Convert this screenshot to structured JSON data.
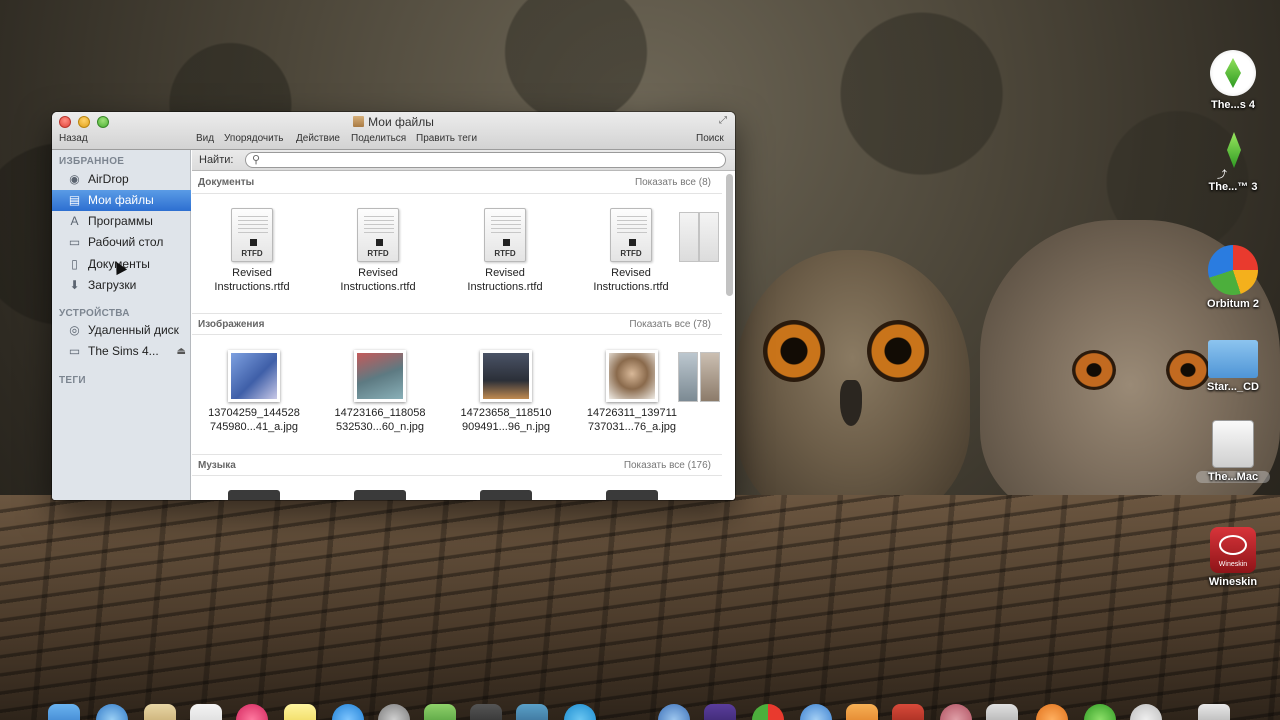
{
  "window": {
    "title": "Мои файлы",
    "toolbar": {
      "back": "Назад",
      "view": "Вид",
      "arrange": "Упорядочить",
      "action": "Действие",
      "share": "Поделиться",
      "tags": "Править теги",
      "search": "Поиск"
    },
    "sidebar": {
      "favorites_header": "ИЗБРАННОЕ",
      "favorites": [
        {
          "label": "AirDrop",
          "icon": "airdrop-icon"
        },
        {
          "label": "Мои файлы",
          "icon": "all-files-icon",
          "selected": true
        },
        {
          "label": "Программы",
          "icon": "applications-icon"
        },
        {
          "label": "Рабочий стол",
          "icon": "desktop-icon"
        },
        {
          "label": "Документы",
          "icon": "documents-icon"
        },
        {
          "label": "Загрузки",
          "icon": "downloads-icon"
        }
      ],
      "devices_header": "УСТРОЙСТВА",
      "devices": [
        {
          "label": "Удаленный диск",
          "icon": "remote-disc-icon"
        },
        {
          "label": "The Sims 4...",
          "icon": "disk-icon",
          "eject": "⏏"
        }
      ],
      "tags_header": "ТЕГИ"
    },
    "search_bar": {
      "label": "Найти:",
      "value": "",
      "placeholder": ""
    },
    "sections": [
      {
        "title": "Документы",
        "show_all": "Показать все (8)",
        "items": [
          {
            "name_line1": "Revised",
            "name_line2": "Instructions.rtfd",
            "ext": "RTFD"
          },
          {
            "name_line1": "Revised",
            "name_line2": "Instructions.rtfd",
            "ext": "RTFD"
          },
          {
            "name_line1": "Revised",
            "name_line2": "Instructions.rtfd",
            "ext": "RTFD"
          },
          {
            "name_line1": "Revised",
            "name_line2": "Instructions.rtfd",
            "ext": "RTFD"
          }
        ]
      },
      {
        "title": "Изображения",
        "show_all": "Показать все (78)",
        "items": [
          {
            "name_line1": "13704259_144528",
            "name_line2": "745980...41_a.jpg",
            "color": "#3f5fa8"
          },
          {
            "name_line1": "14723166_118058",
            "name_line2": "532530...60_n.jpg",
            "color": "#5d7a82"
          },
          {
            "name_line1": "14723658_118510",
            "name_line2": "909491...96_n.jpg",
            "color": "#2b2f38"
          },
          {
            "name_line1": "14726311_139711",
            "name_line2": "737031...76_a.jpg",
            "color": "#8a6a4c"
          }
        ]
      },
      {
        "title": "Музыка",
        "show_all": "Показать все (176)"
      }
    ]
  },
  "desktop_icons": [
    {
      "label": "The...s 4",
      "icon": "sims-plumbob-icon"
    },
    {
      "label": "The...™ 3",
      "icon": "sims3-alias-icon"
    },
    {
      "label": "Orbitum 2",
      "icon": "orbitum-browser-icon"
    },
    {
      "label": "Star..._CD",
      "icon": "folder-icon"
    },
    {
      "label": "The...Mac",
      "icon": "external-drive-icon"
    },
    {
      "label": "Wineskin",
      "icon": "wineskin-icon",
      "badge": "Wineskin"
    }
  ],
  "colors": {
    "selection_blue": "#2d6fd1",
    "sidebar_bg": "#dfe4ea"
  }
}
